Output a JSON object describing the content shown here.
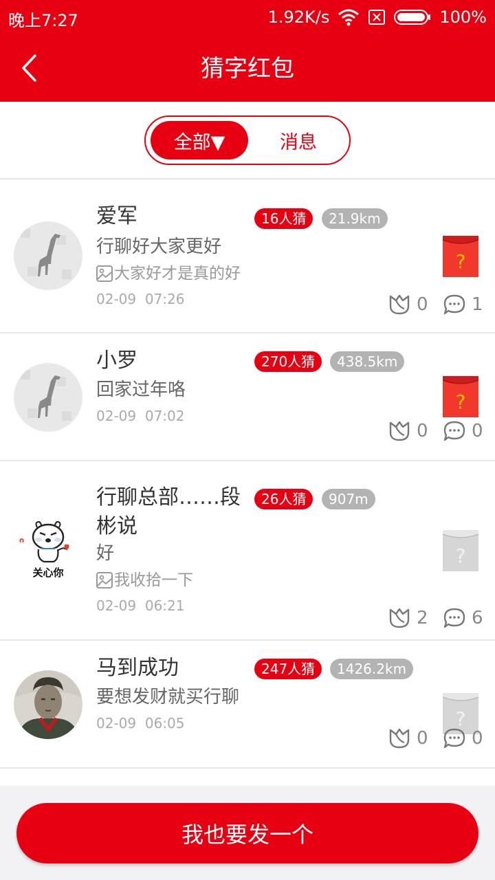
{
  "status_bar": {
    "time": "晚上7:27",
    "speed": "1.92K/s",
    "battery": "100%"
  },
  "header": {
    "title": "猜字红包",
    "back_icon": "chevron-left-icon"
  },
  "filter": {
    "all_label": "全部▼",
    "message_label": "消息"
  },
  "posts": [
    {
      "name": "爱军",
      "guess": "16人猜",
      "distance": "21.9km",
      "content": "行聊好大家更好",
      "image_note": "大家好才是真的好",
      "date": "02-09",
      "clock": "07:26",
      "flowers": "0",
      "comments": "1",
      "envelope": "active"
    },
    {
      "name": "小罗",
      "guess": "270人猜",
      "distance": "438.5km",
      "content": "回家过年咯",
      "image_note": "",
      "date": "02-09",
      "clock": "07:02",
      "flowers": "0",
      "comments": "0",
      "envelope": "active"
    },
    {
      "name": "行聊总部……段彬说",
      "guess": "26人猜",
      "distance": "907m",
      "content": "好",
      "image_note": "我收拾一下",
      "avatar_text": "关心你",
      "date": "02-09",
      "clock": "06:21",
      "flowers": "2",
      "comments": "6",
      "envelope": "inactive"
    },
    {
      "name": "马到成功",
      "guess": "247人猜",
      "distance": "1426.2km",
      "content": "要想发财就买行聊",
      "image_note": "",
      "date": "02-09",
      "clock": "06:05",
      "flowers": "0",
      "comments": "0",
      "envelope": "inactive"
    }
  ],
  "action": {
    "send_label": "我也要发一个"
  },
  "colors": {
    "brand_red": "#e60012",
    "envelope_red": "#f0392c",
    "envelope_gray": "#d6d6d6",
    "gold": "#f5c200"
  }
}
